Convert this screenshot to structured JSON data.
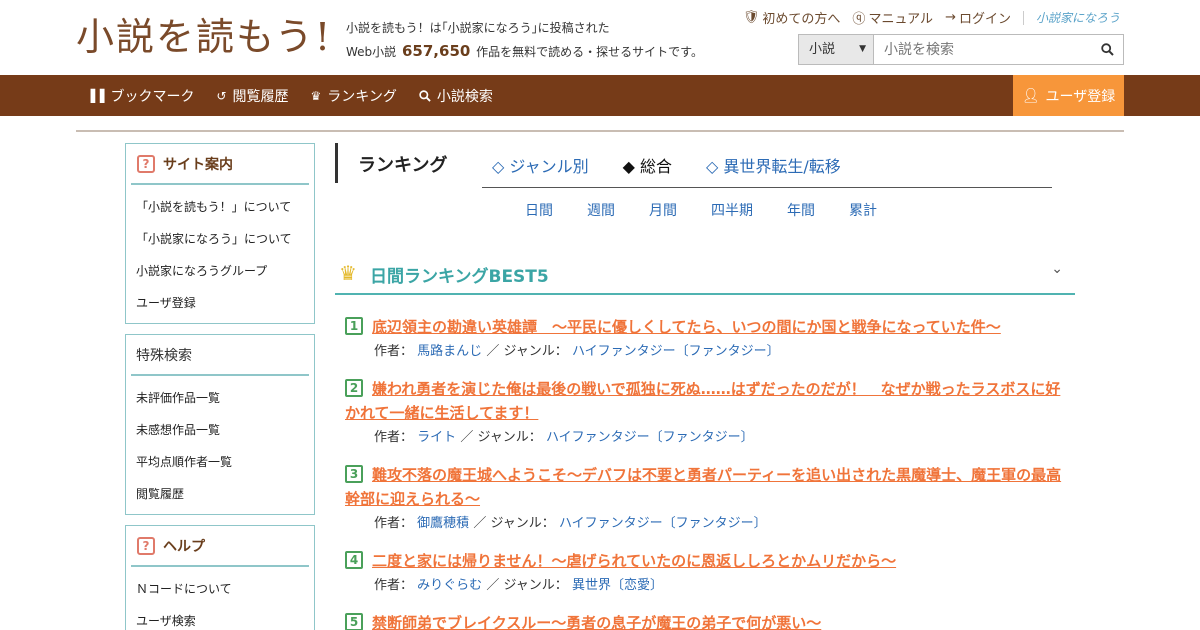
{
  "header": {
    "logo_text": "小説を読もう!",
    "tagline_line1": "小説を読もう！は｢小説家になろう｣に投稿された",
    "tagline_prefix": "Web小説",
    "tagline_count": "657,650",
    "tagline_suffix": "作品を無料で読める・探せるサイトです。",
    "toplinks": [
      {
        "label": "初めての方へ",
        "icon": "shield-icon"
      },
      {
        "label": "マニュアル",
        "icon": "question-circle-icon"
      },
      {
        "label": "ログイン",
        "icon": "login-icon"
      }
    ],
    "narou_logo": "小説家になろう",
    "search": {
      "category": "小説",
      "placeholder": "小説を検索"
    }
  },
  "nav": {
    "items": [
      {
        "label": "ブックマーク",
        "icon": "bookshelf-icon"
      },
      {
        "label": "閲覧履歴",
        "icon": "history-icon"
      },
      {
        "label": "ランキング",
        "icon": "crown-icon"
      },
      {
        "label": "小説検索",
        "icon": "search-icon"
      }
    ],
    "register_label": "ユーザ登録"
  },
  "sidebar": {
    "site_guide": {
      "title": "サイト案内",
      "items": [
        "「小説を読もう！」について",
        "「小説家になろう」について",
        "小説家になろうグループ",
        "ユーザ登録"
      ]
    },
    "special_search": {
      "title": "特殊検索",
      "items": [
        "未評価作品一覧",
        "未感想作品一覧",
        "平均点順作者一覧",
        "閲覧履歴"
      ]
    },
    "help": {
      "title": "ヘルプ",
      "items": [
        "Ｎコードについて",
        "ユーザ検索"
      ]
    }
  },
  "ranking": {
    "title": "ランキング",
    "tabs": [
      {
        "label": "◇ ジャンル別",
        "active": false
      },
      {
        "label": "◆ 総合",
        "active": true
      },
      {
        "label": "◇ 異世界転生/転移",
        "active": false
      }
    ],
    "periods": [
      "日間",
      "週間",
      "月間",
      "四半期",
      "年間",
      "累計"
    ],
    "best_title": "日間ランキングBEST5",
    "author_label": "作者：",
    "genre_label": "／ ジャンル：",
    "entries": [
      {
        "rank": "1",
        "title": "底辺領主の勘違い英雄譚　～平民に優しくしてたら、いつの間にか国と戦争になっていた件～",
        "author": "馬路まんじ",
        "genre": "ハイファンタジー〔ファンタジー〕"
      },
      {
        "rank": "2",
        "title": "嫌われ勇者を演じた俺は最後の戦いで孤独に死ぬ……はずだったのだが！　なぜか戦ったラスボスに好かれて一緒に生活してます！",
        "author": "ライト",
        "genre": "ハイファンタジー〔ファンタジー〕"
      },
      {
        "rank": "3",
        "title": "難攻不落の魔王城へようこそ～デバフは不要と勇者パーティーを追い出された黒魔導士、魔王軍の最高幹部に迎えられる～",
        "author": "御鷹穂積",
        "genre": "ハイファンタジー〔ファンタジー〕"
      },
      {
        "rank": "4",
        "title": "二度と家には帰りません！～虐げられていたのに恩返ししろとかムリだから～",
        "author": "みりぐらむ",
        "genre": "異世界〔恋愛〕"
      },
      {
        "rank": "5",
        "title": "禁断師弟でブレイクスルー～勇者の息子が魔王の弟子で何が悪い～",
        "author": "",
        "genre": ""
      }
    ]
  }
}
